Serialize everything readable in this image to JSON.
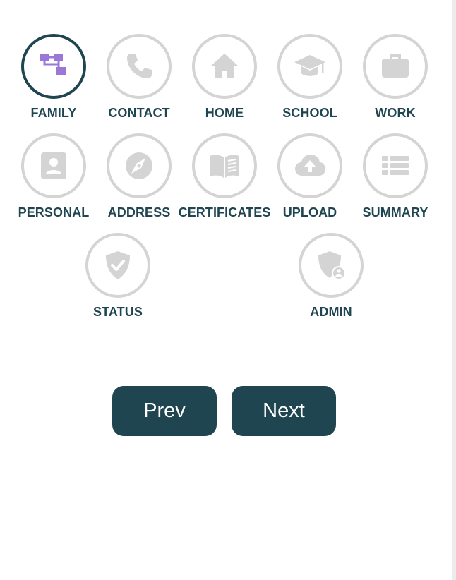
{
  "steps": [
    {
      "id": "family",
      "label": "FAMILY",
      "icon": "family-tree-icon",
      "active": true
    },
    {
      "id": "contact",
      "label": "CONTACT",
      "icon": "phone-icon",
      "active": false
    },
    {
      "id": "home",
      "label": "HOME",
      "icon": "house-icon",
      "active": false
    },
    {
      "id": "school",
      "label": "SCHOOL",
      "icon": "graduation-cap-icon",
      "active": false
    },
    {
      "id": "work",
      "label": "WORK",
      "icon": "briefcase-icon",
      "active": false
    },
    {
      "id": "personal",
      "label": "PERSONAL",
      "icon": "id-badge-icon",
      "active": false
    },
    {
      "id": "address",
      "label": "ADDRESS",
      "icon": "compass-icon",
      "active": false
    },
    {
      "id": "certificates",
      "label": "CERTIFICATES",
      "icon": "open-book-icon",
      "active": false
    },
    {
      "id": "upload",
      "label": "UPLOAD",
      "icon": "cloud-upload-icon",
      "active": false
    },
    {
      "id": "summary",
      "label": "SUMMARY",
      "icon": "list-icon",
      "active": false
    },
    {
      "id": "status",
      "label": "STATUS",
      "icon": "shield-check-icon",
      "active": false
    },
    {
      "id": "admin",
      "label": "ADMIN",
      "icon": "shield-user-icon",
      "active": false
    }
  ],
  "buttons": {
    "prev_label": "Prev",
    "next_label": "Next"
  },
  "colors": {
    "primary": "#1f4550",
    "accent": "#9b78d6",
    "inactive": "#d4d4d4",
    "background": "#ffffff"
  }
}
